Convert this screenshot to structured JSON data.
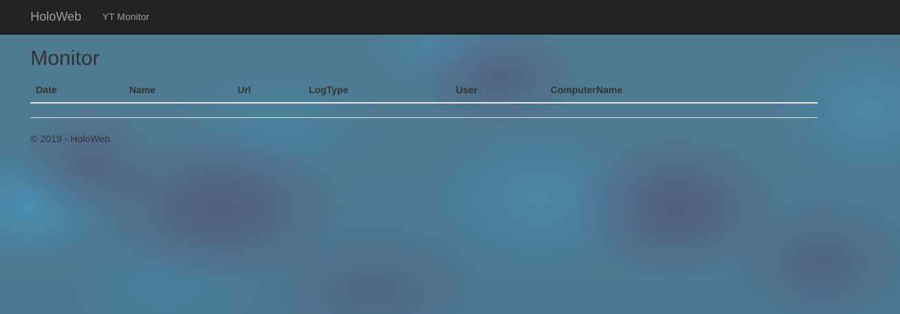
{
  "navbar": {
    "brand": "HoloWeb",
    "links": [
      {
        "label": "YT Monitor"
      }
    ]
  },
  "main": {
    "title": "Monitor",
    "table": {
      "columns": [
        "Date",
        "Name",
        "Url",
        "LogType",
        "User",
        "ComputerName"
      ],
      "rows": []
    }
  },
  "footer": {
    "text": "© 2019 - HoloWeb"
  }
}
